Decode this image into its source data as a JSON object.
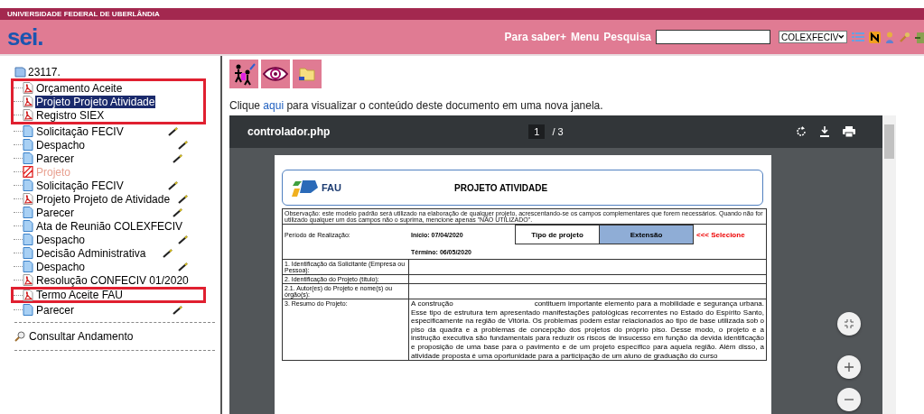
{
  "institution": "UNIVERSIDADE FEDERAL DE UBERLÂNDIA",
  "logo": "sei.",
  "header_links": [
    "Para saber+",
    "Menu",
    "Pesquisa"
  ],
  "unit_select": {
    "value": "COLEXFECIV"
  },
  "tree": {
    "label": "23117.",
    "children": [
      {
        "label": "Orçamento Aceite",
        "kind": "pdf",
        "selected": false,
        "signed": false,
        "highlighted": true
      },
      {
        "label": "Projeto Projeto Atividade",
        "kind": "pdf",
        "selected": true,
        "signed": false,
        "highlighted": true
      },
      {
        "label": "Registro SIEX",
        "kind": "pdf",
        "selected": false,
        "signed": false,
        "highlighted": true
      },
      {
        "label": "Solicitação FECIV",
        "kind": "doc",
        "selected": false,
        "signed": true,
        "highlighted": false
      },
      {
        "label": "Despacho",
        "kind": "doc",
        "selected": false,
        "signed": true,
        "highlighted": false
      },
      {
        "label": "Parecer",
        "kind": "doc",
        "selected": false,
        "signed": true,
        "highlighted": false
      },
      {
        "label": "Projeto",
        "kind": "canceled",
        "selected": false,
        "signed": false,
        "highlighted": false
      },
      {
        "label": "Solicitação FECIV",
        "kind": "doc",
        "selected": false,
        "signed": true,
        "highlighted": false
      },
      {
        "label": "Projeto Projeto de Atividade",
        "kind": "pdf",
        "selected": false,
        "signed": true,
        "highlighted": false
      },
      {
        "label": "Parecer",
        "kind": "doc",
        "selected": false,
        "signed": true,
        "highlighted": false
      },
      {
        "label": "Ata de Reunião COLEXFECIV",
        "kind": "doc",
        "selected": false,
        "signed": false,
        "highlighted": false
      },
      {
        "label": "Despacho",
        "kind": "doc",
        "selected": false,
        "signed": true,
        "highlighted": false
      },
      {
        "label": "Decisão Administrativa",
        "kind": "doc",
        "selected": false,
        "signed": true,
        "highlighted": false
      },
      {
        "label": "Despacho",
        "kind": "doc",
        "selected": false,
        "signed": true,
        "highlighted": false
      },
      {
        "label": "Resolução CONFECIV 01/2020",
        "kind": "pdf",
        "selected": false,
        "signed": false,
        "highlighted": false
      },
      {
        "label": "Termo Aceite FAU",
        "kind": "pdf",
        "selected": false,
        "signed": false,
        "highlighted": true
      },
      {
        "label": "Parecer",
        "kind": "doc",
        "selected": false,
        "signed": true,
        "highlighted": false
      }
    ]
  },
  "consult": "Consultar Andamento",
  "open_note": {
    "before": "Clique ",
    "link": "aqui",
    "after": " para visualizar o conteúdo deste documento em uma nova janela."
  },
  "viewer": {
    "filename": "controlador.php",
    "page": "1",
    "total": "/ 3"
  },
  "document": {
    "org": "FAU",
    "title": "PROJETO ATIVIDADE",
    "note": "Observação: este modelo padrão será utilizado na elaboração de qualquer projeto, acrescentando-se os campos complementares que forem necessários. Quando não for utilizado qualquer um dos campos não o suprima, mencione apenas \"NÃO UTILIZADO\".",
    "period_label": "Período de Realização:",
    "start": "Início: 07/04/2020",
    "end": "Término: 06/05/2020",
    "type_label": "Tipo de projeto",
    "type_value": "Extensão",
    "select_hint": "<<< Selecione",
    "rows": [
      {
        "label": "1. Identificação da Solicitante (Empresa ou Pessoa):"
      },
      {
        "label": "2. Identificação do Projeto (título):"
      },
      {
        "label": "2.1. Autor(es) do Projeto e nome(s) ou órgão(s):"
      }
    ],
    "summary_label": "3. Resumo do Projeto:",
    "summary_start": "A construção",
    "summary": "contituem importante elemento para a mobilidade e segurança urbana. Esse tipo de estrutura tem apresentado manifestações patológicas recorrentes no Estado do Espírito Santo, especificamente na região de Vitória. Os problemas podem estar relacionados ao tipo de base utilizada sob o piso da quadra e a problemas de concepção dos projetos do próprio piso. Desse modo, o projeto e a instrução executiva são fundamentais para reduzir os riscos de insucesso em função da devida identificação e proposição de uma base para o pavimento e de um projeto específico para aquela região. Além disso, a atividade proposta é uma oportunidade para a participação de um aluno de graduação do curso"
  }
}
